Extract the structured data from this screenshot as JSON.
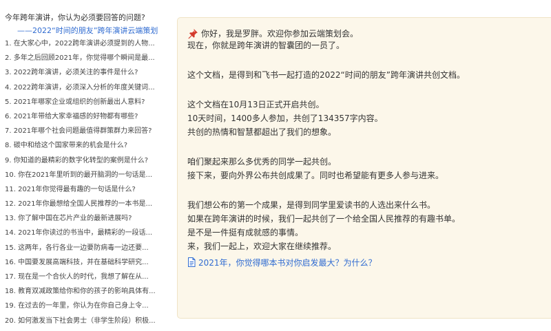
{
  "sidebar": {
    "title": "今年跨年演讲，你认为必须要回答的问题?",
    "subtitle": "——2022“时间的朋友”跨年演讲云端策划",
    "items": [
      "1. 在大家心中，2022跨年演讲必须提到的人物...",
      "2. 多年之后回顾2021年，你觉得哪个瞬间是最...",
      "3. 2022跨年演讲，必须关注的事件是什么?",
      "4. 2022跨年演讲，必须深入分析的年度关键词...",
      "5. 2021年哪家企业或组织的创新最出人意料?",
      "6. 2021年带给大家幸福感的好物都有哪些?",
      "7. 2021年哪个社会问题最值得群策群力来回答?",
      "8. 碳中和给这个国家带来的机会是什么?",
      "9. 你知道的最精彩的数字化转型的案例是什么?",
      "10. 你在2021年里听到的最开脑洞的一句话是...",
      "11. 2021年你觉得最有趣的一句话是什么?",
      "12. 2021年你最想给全国人民推荐的一本书是...",
      "13. 你了解中国在芯片产业的最新进展吗?",
      "14. 2021年你读过的书当中，最精彩的一段话...",
      "15. 这两年，各行各业一边要防病毒一边还要...",
      "16. 中国要发展高端科技，并在基础科学研究...",
      "17. 现在是一个合伙人的时代，我想了解在从...",
      "18. 教育双减政策给你和你的孩子的影响具体有...",
      "19. 在过去的一年里，你认为在你自己身上令...",
      "20. 如何激发当下社会男士（非学生阶段）积极..."
    ]
  },
  "content": {
    "pin_icon": "pushpin-icon",
    "lines": [
      "你好，我是罗胖。欢迎你参加云端策划会。",
      "现在，你就是跨年演讲的智囊团的一员了。",
      "",
      "这个文档，是得到和飞书一起打造的2022“时间的朋友”跨年演讲共创文档。",
      "",
      "这个文档在10月13日正式开启共创。",
      "10天时间，1400多人参加，共创了134357字内容。",
      "共创的热情和智慧都超出了我们的想象。",
      "",
      "咱们聚起来那么多优秀的同学一起共创。",
      "接下来，要向外界公布共创成果了。同时也希望能有更多人参与进来。",
      "",
      "我们想公布的第一个成果，是得到同学里爱读书的人选出来什么书。",
      "如果在跨年演讲的时候，我们一起共创了一个给全国人民推荐的有趣书单。",
      "是不是一件挺有成就感的事情。",
      "来，我们一起上，欢迎大家在继续推荐。"
    ],
    "doc_link": "2021年，你觉得哪本书对你启发最大？为什么？",
    "accent_color": "#2f6bd1"
  }
}
